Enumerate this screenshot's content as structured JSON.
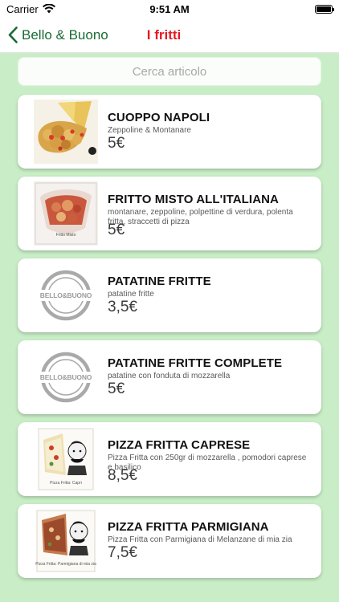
{
  "status_bar": {
    "carrier": "Carrier",
    "time": "9:51 AM"
  },
  "nav": {
    "back_label": "Bello & Buono",
    "title": "I fritti"
  },
  "search": {
    "placeholder": "Cerca articolo",
    "value": ""
  },
  "items": [
    {
      "name": "CUOPPO NAPOLI",
      "description": "Zeppoline & Montanare",
      "price": "5€",
      "image": "cuoppo-photo"
    },
    {
      "name": "FRITTO MISTO ALL'ITALIANA",
      "description": "montanare, zeppoline, polpettine di verdura, polenta fritta, straccetti di pizza",
      "price": "5€",
      "image": "fritto-misto-photo",
      "image_caption": "Fritto Misto"
    },
    {
      "name": "PATATINE FRITTE",
      "description": "patatine fritte",
      "price": "3,5€",
      "image": "bello-buono-logo",
      "logo_text": "BELLO&BUONO"
    },
    {
      "name": "PATATINE FRITTE COMPLETE",
      "description": "patatine con fonduta di mozzarella",
      "price": "5€",
      "image": "bello-buono-logo",
      "logo_text": "BELLO&BUONO"
    },
    {
      "name": "PIZZA FRITTA CAPRESE",
      "description": "Pizza Fritta con 250gr di mozzarella , pomodori caprese e basilico",
      "price": "8,5€",
      "image": "pizza-caprese-illustration",
      "image_caption": "Pizza Fritta: Capri"
    },
    {
      "name": "PIZZA FRITTA PARMIGIANA",
      "description": "Pizza Fritta con Parmigiana di Melanzane di mia zia",
      "price": "7,5€",
      "image": "pizza-parmigiana-illustration",
      "image_caption": "Pizza Fritta: Parmigiana di mia zia"
    }
  ],
  "colors": {
    "background": "#c9eec7",
    "back_accent": "#1a6b34",
    "title_accent": "#e31b23"
  }
}
